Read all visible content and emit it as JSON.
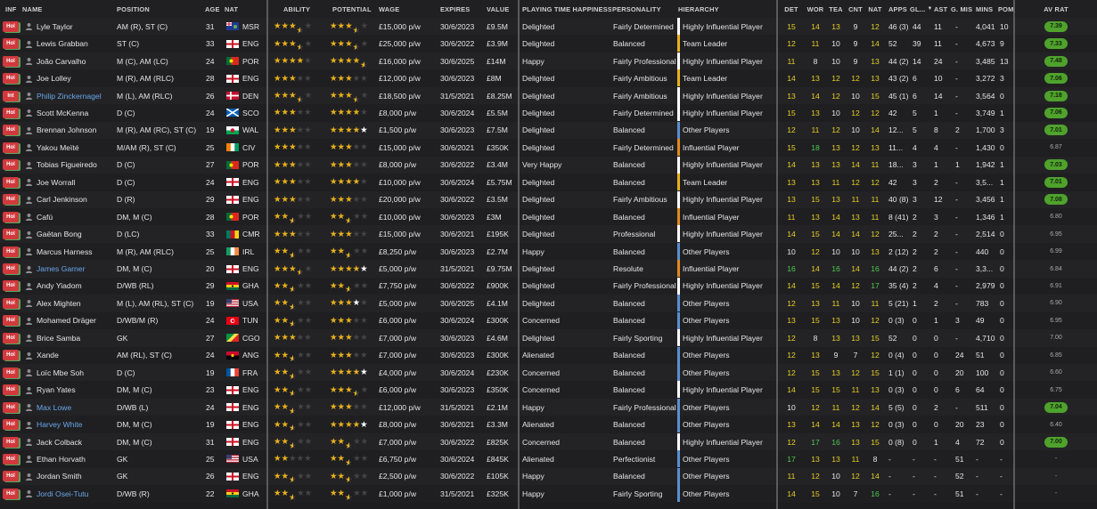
{
  "headers": {
    "inf": "INF",
    "name": "NAME",
    "position": "POSITION",
    "age": "AGE",
    "nat": "NAT",
    "ability": "ABILITY",
    "potential": "POTENTIAL",
    "wage": "WAGE",
    "expires": "EXPIRES",
    "value": "VALUE",
    "pth": "PLAYING TIME HAPPINESS",
    "personality": "PERSONALITY",
    "hierarchy": "HIERARCHY",
    "det": "DET",
    "wor": "WOR",
    "tea": "TEA",
    "cnt": "CNT",
    "nat2": "NAT",
    "apps": "APPS",
    "gls": "GL...",
    "ast": "AST",
    "gmis": "G. MIS",
    "mins": "MINS",
    "pom": "POM",
    "avrat": "AV RAT"
  },
  "colors": {
    "hier_highly": "#ffffff",
    "hier_leader": "#e8b21d",
    "hier_influential": "#e08a1e",
    "hier_other": "#5b8fd0"
  },
  "players": [
    {
      "inf": "Hol",
      "name": "Lyle Taylor",
      "pos": "AM (R), ST (C)",
      "age": "31",
      "nat": "MSR",
      "flag": "msr",
      "ab": 3.5,
      "abw": 0,
      "pot": 3.5,
      "potw": 0,
      "wage": "£15,000 p/w",
      "exp": "30/6/2023",
      "val": "£9.5M",
      "pth": "Delighted",
      "pers": "Fairly Determined",
      "hier": "Highly Influential Player",
      "hc": "highly",
      "det": "15",
      "wor": "14",
      "tea": "13",
      "cnt": "9",
      "nat2": "12",
      "apps": "46 (3)",
      "gls": "44",
      "ast": "11",
      "gmis": "-",
      "mins": "4,041",
      "pom": "10",
      "avr": "7.39",
      "pill": true,
      "link": false
    },
    {
      "inf": "Hol",
      "name": "Lewis Grabban",
      "pos": "ST (C)",
      "age": "33",
      "nat": "ENG",
      "flag": "eng",
      "ab": 3.5,
      "abw": 0,
      "pot": 3.5,
      "potw": 0,
      "wage": "£25,000 p/w",
      "exp": "30/6/2022",
      "val": "£3.9M",
      "pth": "Delighted",
      "pers": "Balanced",
      "hier": "Team Leader",
      "hc": "leader",
      "det": "12",
      "wor": "11",
      "tea": "10",
      "cnt": "9",
      "nat2": "14",
      "apps": "52",
      "gls": "39",
      "ast": "11",
      "gmis": "-",
      "mins": "4,673",
      "pom": "9",
      "avr": "7.33",
      "pill": true,
      "link": false
    },
    {
      "inf": "Hol",
      "name": "João Carvalho",
      "pos": "M (C), AM (LC)",
      "age": "24",
      "nat": "POR",
      "flag": "por",
      "ab": 4,
      "abw": 0,
      "pot": 4.5,
      "potw": 0,
      "wage": "£16,000 p/w",
      "exp": "30/6/2025",
      "val": "£14M",
      "pth": "Happy",
      "pers": "Fairly Professional",
      "hier": "Highly Influential Player",
      "hc": "highly",
      "det": "11",
      "wor": "8",
      "tea": "10",
      "cnt": "9",
      "nat2": "13",
      "apps": "44 (2)",
      "gls": "14",
      "ast": "24",
      "gmis": "-",
      "mins": "3,485",
      "pom": "13",
      "avr": "7.48",
      "pill": true,
      "link": false
    },
    {
      "inf": "Hol",
      "name": "Joe Lolley",
      "pos": "M (R), AM (RLC)",
      "age": "28",
      "nat": "ENG",
      "flag": "eng",
      "ab": 3,
      "abw": 0,
      "pot": 3,
      "potw": 0,
      "wage": "£12,000 p/w",
      "exp": "30/6/2023",
      "val": "£8M",
      "pth": "Delighted",
      "pers": "Fairly Ambitious",
      "hier": "Team Leader",
      "hc": "leader",
      "det": "14",
      "wor": "13",
      "tea": "12",
      "cnt": "12",
      "nat2": "13",
      "apps": "43 (2)",
      "gls": "6",
      "ast": "10",
      "gmis": "-",
      "mins": "3,272",
      "pom": "3",
      "avr": "7.06",
      "pill": true,
      "link": false
    },
    {
      "inf": "Int",
      "name": "Philip Zinckernagel",
      "pos": "M (L), AM (RLC)",
      "age": "26",
      "nat": "DEN",
      "flag": "den",
      "ab": 3.5,
      "abw": 0,
      "pot": 3.5,
      "potw": 0,
      "wage": "£18,500 p/w",
      "exp": "31/5/2021",
      "val": "£8.25M",
      "pth": "Delighted",
      "pers": "Fairly Ambitious",
      "hier": "Highly Influential Player",
      "hc": "highly",
      "det": "13",
      "wor": "14",
      "tea": "12",
      "cnt": "10",
      "nat2": "15",
      "apps": "45 (1)",
      "gls": "6",
      "ast": "14",
      "gmis": "-",
      "mins": "3,564",
      "pom": "0",
      "avr": "7.18",
      "pill": true,
      "link": true
    },
    {
      "inf": "Hol",
      "name": "Scott McKenna",
      "pos": "D (C)",
      "age": "24",
      "nat": "SCO",
      "flag": "sco",
      "ab": 3,
      "abw": 0,
      "pot": 4,
      "potw": 0,
      "wage": "£8,000 p/w",
      "exp": "30/6/2024",
      "val": "£5.5M",
      "pth": "Delighted",
      "pers": "Fairly Determined",
      "hier": "Highly Influential Player",
      "hc": "highly",
      "det": "15",
      "wor": "13",
      "tea": "10",
      "cnt": "12",
      "nat2": "12",
      "apps": "42",
      "gls": "5",
      "ast": "1",
      "gmis": "-",
      "mins": "3,749",
      "pom": "1",
      "avr": "7.06",
      "pill": true,
      "link": false
    },
    {
      "inf": "Hol",
      "name": "Brennan Johnson",
      "pos": "M (R), AM (RC), ST (C)",
      "age": "19",
      "nat": "WAL",
      "flag": "wal",
      "ab": 3,
      "abw": 0,
      "pot": 4,
      "potw": 1,
      "wage": "£1,500 p/w",
      "exp": "30/6/2023",
      "val": "£7.5M",
      "pth": "Delighted",
      "pers": "Balanced",
      "hier": "Other Players",
      "hc": "other",
      "det": "12",
      "wor": "11",
      "tea": "12",
      "cnt": "10",
      "nat2": "14",
      "apps": "12...",
      "gls": "5",
      "ast": "8",
      "gmis": "2",
      "mins": "1,700",
      "pom": "3",
      "avr": "7.01",
      "pill": true,
      "link": false
    },
    {
      "inf": "Hol",
      "name": "Yakou Meïté",
      "pos": "M/AM (R), ST (C)",
      "age": "25",
      "nat": "CIV",
      "flag": "civ",
      "ab": 3,
      "abw": 0,
      "pot": 3,
      "potw": 0,
      "wage": "£15,000 p/w",
      "exp": "30/6/2021",
      "val": "£350K",
      "pth": "Delighted",
      "pers": "Fairly Determined",
      "hier": "Influential Player",
      "hc": "influential",
      "det": "15",
      "wor": "18",
      "tea": "13",
      "cnt": "12",
      "nat2": "13",
      "apps": "11...",
      "gls": "4",
      "ast": "4",
      "gmis": "-",
      "mins": "1,430",
      "pom": "0",
      "avr": "6.87",
      "pill": false,
      "link": false
    },
    {
      "inf": "Hol",
      "name": "Tobias Figueiredo",
      "pos": "D (C)",
      "age": "27",
      "nat": "POR",
      "flag": "por",
      "ab": 3,
      "abw": 0,
      "pot": 3,
      "potw": 0,
      "wage": "£8,000 p/w",
      "exp": "30/6/2022",
      "val": "£3.4M",
      "pth": "Very Happy",
      "pers": "Balanced",
      "hier": "Highly Influential Player",
      "hc": "highly",
      "det": "14",
      "wor": "13",
      "tea": "13",
      "cnt": "14",
      "nat2": "11",
      "apps": "18...",
      "gls": "3",
      "ast": "1",
      "gmis": "1",
      "mins": "1,942",
      "pom": "1",
      "avr": "7.03",
      "pill": true,
      "link": false
    },
    {
      "inf": "Hol",
      "name": "Joe Worrall",
      "pos": "D (C)",
      "age": "24",
      "nat": "ENG",
      "flag": "eng",
      "ab": 3,
      "abw": 0,
      "pot": 4,
      "potw": 0,
      "wage": "£10,000 p/w",
      "exp": "30/6/2024",
      "val": "£5.75M",
      "pth": "Delighted",
      "pers": "Balanced",
      "hier": "Team Leader",
      "hc": "leader",
      "det": "13",
      "wor": "13",
      "tea": "11",
      "cnt": "12",
      "nat2": "12",
      "apps": "42",
      "gls": "3",
      "ast": "2",
      "gmis": "-",
      "mins": "3,5...",
      "pom": "1",
      "avr": "7.01",
      "pill": true,
      "link": false
    },
    {
      "inf": "Hol",
      "name": "Carl Jenkinson",
      "pos": "D (R)",
      "age": "29",
      "nat": "ENG",
      "flag": "eng",
      "ab": 3,
      "abw": 0,
      "pot": 3,
      "potw": 0,
      "wage": "£20,000 p/w",
      "exp": "30/6/2022",
      "val": "£3.5M",
      "pth": "Delighted",
      "pers": "Fairly Ambitious",
      "hier": "Highly Influential Player",
      "hc": "highly",
      "det": "13",
      "wor": "15",
      "tea": "13",
      "cnt": "11",
      "nat2": "11",
      "apps": "40 (8)",
      "gls": "3",
      "ast": "12",
      "gmis": "-",
      "mins": "3,456",
      "pom": "1",
      "avr": "7.08",
      "pill": true,
      "link": false
    },
    {
      "inf": "Hol",
      "name": "Cafú",
      "pos": "DM, M (C)",
      "age": "28",
      "nat": "POR",
      "flag": "por",
      "ab": 2.5,
      "abw": 0,
      "pot": 2.5,
      "potw": 0,
      "wage": "£10,000 p/w",
      "exp": "30/6/2023",
      "val": "£3M",
      "pth": "Delighted",
      "pers": "Balanced",
      "hier": "Influential Player",
      "hc": "influential",
      "det": "11",
      "wor": "13",
      "tea": "14",
      "cnt": "13",
      "nat2": "11",
      "apps": "8 (41)",
      "gls": "2",
      "ast": "3",
      "gmis": "-",
      "mins": "1,346",
      "pom": "1",
      "avr": "6.80",
      "pill": false,
      "link": false
    },
    {
      "inf": "Hol",
      "name": "Gaëtan Bong",
      "pos": "D (LC)",
      "age": "33",
      "nat": "CMR",
      "flag": "cmr",
      "ab": 3,
      "abw": 0,
      "pot": 3,
      "potw": 0,
      "wage": "£15,000 p/w",
      "exp": "30/6/2021",
      "val": "£195K",
      "pth": "Delighted",
      "pers": "Professional",
      "hier": "Highly Influential Player",
      "hc": "highly",
      "det": "14",
      "wor": "15",
      "tea": "14",
      "cnt": "14",
      "nat2": "12",
      "apps": "25...",
      "gls": "2",
      "ast": "2",
      "gmis": "-",
      "mins": "2,514",
      "pom": "0",
      "avr": "6.95",
      "pill": false,
      "link": false
    },
    {
      "inf": "Hol",
      "name": "Marcus Harness",
      "pos": "M (R), AM (RLC)",
      "age": "25",
      "nat": "IRL",
      "flag": "irl",
      "ab": 2.5,
      "abw": 0,
      "pot": 2.5,
      "potw": 0,
      "wage": "£8,250 p/w",
      "exp": "30/6/2023",
      "val": "£2.7M",
      "pth": "Happy",
      "pers": "Balanced",
      "hier": "Other Players",
      "hc": "other",
      "det": "10",
      "wor": "12",
      "tea": "10",
      "cnt": "10",
      "nat2": "13",
      "apps": "2 (12)",
      "gls": "2",
      "ast": "2",
      "gmis": "-",
      "mins": "440",
      "pom": "0",
      "avr": "6.99",
      "pill": false,
      "link": false
    },
    {
      "inf": "Hol",
      "name": "James Garner",
      "pos": "DM, M (C)",
      "age": "20",
      "nat": "ENG",
      "flag": "eng",
      "ab": 3.5,
      "abw": 0,
      "pot": 4,
      "potw": 1,
      "wage": "£5,000 p/w",
      "exp": "31/5/2021",
      "val": "£9.75M",
      "pth": "Delighted",
      "pers": "Resolute",
      "hier": "Influential Player",
      "hc": "influential",
      "det": "16",
      "wor": "14",
      "tea": "16",
      "cnt": "14",
      "nat2": "16",
      "apps": "44 (2)",
      "gls": "2",
      "ast": "6",
      "gmis": "-",
      "mins": "3,3...",
      "pom": "0",
      "avr": "6.84",
      "pill": false,
      "link": true
    },
    {
      "inf": "Hol",
      "name": "Andy Yiadom",
      "pos": "D/WB (RL)",
      "age": "29",
      "nat": "GHA",
      "flag": "gha",
      "ab": 2.5,
      "abw": 0,
      "pot": 2.5,
      "potw": 0,
      "wage": "£7,750 p/w",
      "exp": "30/6/2022",
      "val": "£900K",
      "pth": "Delighted",
      "pers": "Fairly Professional",
      "hier": "Highly Influential Player",
      "hc": "highly",
      "det": "14",
      "wor": "15",
      "tea": "14",
      "cnt": "12",
      "nat2": "17",
      "apps": "35 (4)",
      "gls": "2",
      "ast": "4",
      "gmis": "-",
      "mins": "2,979",
      "pom": "0",
      "avr": "6.91",
      "pill": false,
      "link": false
    },
    {
      "inf": "Hol",
      "name": "Alex Mighten",
      "pos": "M (L), AM (RL), ST (C)",
      "age": "19",
      "nat": "USA",
      "flag": "usa",
      "ab": 2.5,
      "abw": 0,
      "pot": 3,
      "potw": 0.5,
      "wage": "£5,000 p/w",
      "exp": "30/6/2025",
      "val": "£4.1M",
      "pth": "Delighted",
      "pers": "Balanced",
      "hier": "Other Players",
      "hc": "other",
      "det": "12",
      "wor": "13",
      "tea": "11",
      "cnt": "10",
      "nat2": "11",
      "apps": "5 (21)",
      "gls": "1",
      "ast": "2",
      "gmis": "-",
      "mins": "783",
      "pom": "0",
      "avr": "6.90",
      "pill": false,
      "link": false
    },
    {
      "inf": "Hol",
      "name": "Mohamed Dräger",
      "pos": "D/WB/M (R)",
      "age": "24",
      "nat": "TUN",
      "flag": "tun",
      "ab": 2.5,
      "abw": 0,
      "pot": 3,
      "potw": 0,
      "wage": "£6,000 p/w",
      "exp": "30/6/2024",
      "val": "£300K",
      "pth": "Concerned",
      "pers": "Balanced",
      "hier": "Other Players",
      "hc": "other",
      "det": "13",
      "wor": "15",
      "tea": "13",
      "cnt": "10",
      "nat2": "12",
      "apps": "0 (3)",
      "gls": "0",
      "ast": "1",
      "gmis": "3",
      "mins": "49",
      "pom": "0",
      "avr": "6.95",
      "pill": false,
      "link": false
    },
    {
      "inf": "Hol",
      "name": "Brice Samba",
      "pos": "GK",
      "age": "27",
      "nat": "CGO",
      "flag": "cgo",
      "ab": 3,
      "abw": 0,
      "pot": 3,
      "potw": 0,
      "wage": "£7,000 p/w",
      "exp": "30/6/2023",
      "val": "£4.6M",
      "pth": "Delighted",
      "pers": "Fairly Sporting",
      "hier": "Highly Influential Player",
      "hc": "highly",
      "det": "12",
      "wor": "8",
      "tea": "13",
      "cnt": "13",
      "nat2": "15",
      "apps": "52",
      "gls": "0",
      "ast": "0",
      "gmis": "-",
      "mins": "4,710",
      "pom": "0",
      "avr": "7.00",
      "pill": false,
      "link": false
    },
    {
      "inf": "Hol",
      "name": "Xande",
      "pos": "AM (RL), ST (C)",
      "age": "24",
      "nat": "ANG",
      "flag": "ang",
      "ab": 2.5,
      "abw": 0,
      "pot": 3,
      "potw": 0,
      "wage": "£7,000 p/w",
      "exp": "30/6/2023",
      "val": "£300K",
      "pth": "Alienated",
      "pers": "Balanced",
      "hier": "Other Players",
      "hc": "other",
      "det": "12",
      "wor": "13",
      "tea": "9",
      "cnt": "7",
      "nat2": "12",
      "apps": "0 (4)",
      "gls": "0",
      "ast": "0",
      "gmis": "24",
      "mins": "51",
      "pom": "0",
      "avr": "6.85",
      "pill": false,
      "link": false
    },
    {
      "inf": "Hol",
      "name": "Loïc Mbe Soh",
      "pos": "D (C)",
      "age": "19",
      "nat": "FRA",
      "flag": "fra",
      "ab": 2.5,
      "abw": 0,
      "pot": 4,
      "potw": 1,
      "wage": "£4,000 p/w",
      "exp": "30/6/2024",
      "val": "£230K",
      "pth": "Concerned",
      "pers": "Balanced",
      "hier": "Other Players",
      "hc": "other",
      "det": "12",
      "wor": "15",
      "tea": "13",
      "cnt": "12",
      "nat2": "15",
      "apps": "1 (1)",
      "gls": "0",
      "ast": "0",
      "gmis": "20",
      "mins": "100",
      "pom": "0",
      "avr": "6.60",
      "pill": false,
      "link": false
    },
    {
      "inf": "Hol",
      "name": "Ryan Yates",
      "pos": "DM, M (C)",
      "age": "23",
      "nat": "ENG",
      "flag": "eng",
      "ab": 2.5,
      "abw": 0,
      "pot": 3.5,
      "potw": 0,
      "wage": "£6,000 p/w",
      "exp": "30/6/2023",
      "val": "£350K",
      "pth": "Concerned",
      "pers": "Balanced",
      "hier": "Highly Influential Player",
      "hc": "highly",
      "det": "14",
      "wor": "15",
      "tea": "15",
      "cnt": "11",
      "nat2": "13",
      "apps": "0 (3)",
      "gls": "0",
      "ast": "0",
      "gmis": "6",
      "mins": "64",
      "pom": "0",
      "avr": "6.75",
      "pill": false,
      "link": false
    },
    {
      "inf": "Hol",
      "name": "Max Lowe",
      "pos": "D/WB (L)",
      "age": "24",
      "nat": "ENG",
      "flag": "eng",
      "ab": 2.5,
      "abw": 0,
      "pot": 3,
      "potw": 0,
      "wage": "£12,000 p/w",
      "exp": "31/5/2021",
      "val": "£2.1M",
      "pth": "Happy",
      "pers": "Fairly Professional",
      "hier": "Other Players",
      "hc": "other",
      "det": "10",
      "wor": "12",
      "tea": "11",
      "cnt": "12",
      "nat2": "14",
      "apps": "5 (5)",
      "gls": "0",
      "ast": "2",
      "gmis": "-",
      "mins": "511",
      "pom": "0",
      "avr": "7.04",
      "pill": true,
      "link": true
    },
    {
      "inf": "Hol",
      "name": "Harvey White",
      "pos": "DM, M (C)",
      "age": "19",
      "nat": "ENG",
      "flag": "eng",
      "ab": 2.5,
      "abw": 0,
      "pot": 4,
      "potw": 1,
      "wage": "£8,000 p/w",
      "exp": "30/6/2021",
      "val": "£3.3M",
      "pth": "Alienated",
      "pers": "Balanced",
      "hier": "Other Players",
      "hc": "other",
      "det": "13",
      "wor": "14",
      "tea": "14",
      "cnt": "13",
      "nat2": "12",
      "apps": "0 (3)",
      "gls": "0",
      "ast": "0",
      "gmis": "20",
      "mins": "23",
      "pom": "0",
      "avr": "6.40",
      "pill": false,
      "link": true
    },
    {
      "inf": "Hol",
      "name": "Jack Colback",
      "pos": "DM, M (C)",
      "age": "31",
      "nat": "ENG",
      "flag": "eng",
      "ab": 2.5,
      "abw": 0,
      "pot": 2.5,
      "potw": 0,
      "wage": "£7,000 p/w",
      "exp": "30/6/2022",
      "val": "£825K",
      "pth": "Concerned",
      "pers": "Balanced",
      "hier": "Highly Influential Player",
      "hc": "highly",
      "det": "12",
      "wor": "17",
      "tea": "16",
      "cnt": "13",
      "nat2": "15",
      "apps": "0 (8)",
      "gls": "0",
      "ast": "1",
      "gmis": "4",
      "mins": "72",
      "pom": "0",
      "avr": "7.00",
      "pill": true,
      "link": false
    },
    {
      "inf": "Hol",
      "name": "Ethan Horvath",
      "pos": "GK",
      "age": "25",
      "nat": "USA",
      "flag": "usa",
      "ab": 2,
      "abw": 0,
      "pot": 2.5,
      "potw": 0,
      "wage": "£6,750 p/w",
      "exp": "30/6/2024",
      "val": "£845K",
      "pth": "Alienated",
      "pers": "Perfectionist",
      "hier": "Other Players",
      "hc": "other",
      "det": "17",
      "wor": "13",
      "tea": "13",
      "cnt": "11",
      "nat2": "8",
      "apps": "-",
      "gls": "-",
      "ast": "-",
      "gmis": "51",
      "mins": "-",
      "pom": "-",
      "avr": "-",
      "pill": false,
      "link": false
    },
    {
      "inf": "Hol",
      "name": "Jordan Smith",
      "pos": "GK",
      "age": "26",
      "nat": "ENG",
      "flag": "eng",
      "ab": 2.5,
      "abw": 0,
      "pot": 2.5,
      "potw": 0,
      "wage": "£2,500 p/w",
      "exp": "30/6/2022",
      "val": "£105K",
      "pth": "Happy",
      "pers": "Balanced",
      "hier": "Other Players",
      "hc": "other",
      "det": "11",
      "wor": "12",
      "tea": "10",
      "cnt": "12",
      "nat2": "14",
      "apps": "-",
      "gls": "-",
      "ast": "-",
      "gmis": "52",
      "mins": "-",
      "pom": "-",
      "avr": "-",
      "pill": false,
      "link": false
    },
    {
      "inf": "Hol",
      "name": "Jordi Osei-Tutu",
      "pos": "D/WB (R)",
      "age": "22",
      "nat": "GHA",
      "flag": "gha",
      "ab": 2.5,
      "abw": 0,
      "pot": 2.5,
      "potw": 0,
      "wage": "£1,000 p/w",
      "exp": "31/5/2021",
      "val": "£325K",
      "pth": "Happy",
      "pers": "Fairly Sporting",
      "hier": "Other Players",
      "hc": "other",
      "det": "14",
      "wor": "15",
      "tea": "10",
      "cnt": "7",
      "nat2": "16",
      "apps": "-",
      "gls": "-",
      "ast": "-",
      "gmis": "51",
      "mins": "-",
      "pom": "-",
      "avr": "-",
      "pill": false,
      "link": true
    }
  ]
}
